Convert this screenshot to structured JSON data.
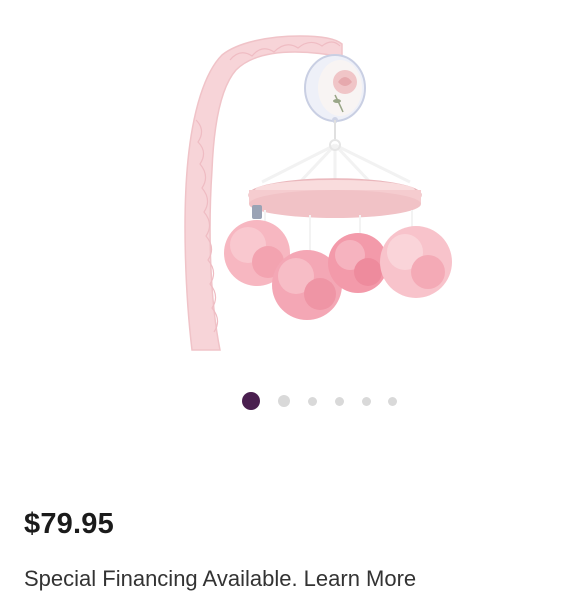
{
  "product": {
    "image_alt": "Pink floral crib mobile with rose music box and pom-pom flowers",
    "price": "$79.95",
    "promo_text": "Special Financing Available. Learn More"
  },
  "carousel": {
    "total_slides": 6,
    "active_index": 0,
    "active_color": "#4a1f4f",
    "inactive_color": "#d9d9d9"
  },
  "colors": {
    "mobile_arm": "#f7d4d8",
    "ring": "#f5cccf",
    "pompom": "#f4a7b5",
    "price_text": "#1b1b1b"
  }
}
